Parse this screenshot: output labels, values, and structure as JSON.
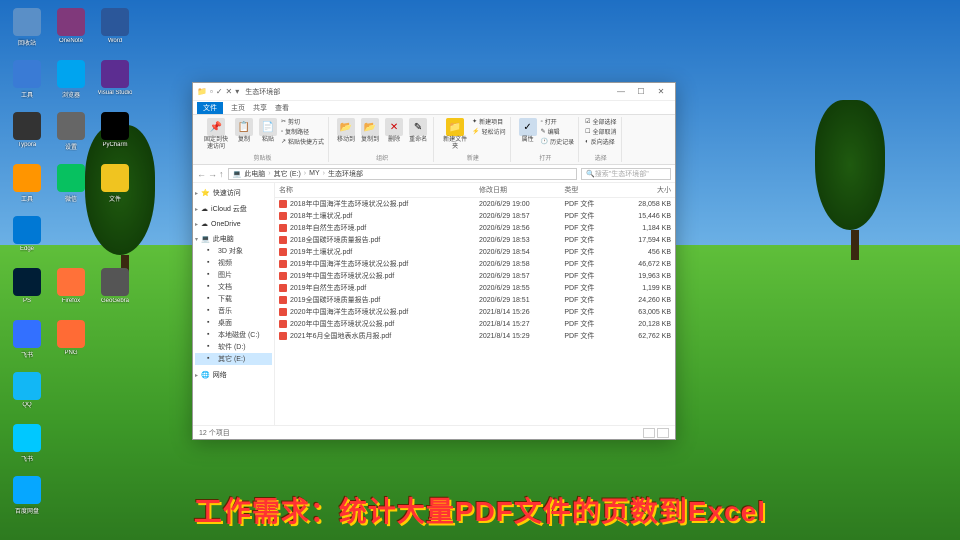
{
  "desktop": {
    "icons": [
      {
        "label": "回收站",
        "color": "#5a8fc7"
      },
      {
        "label": "OneNote",
        "color": "#80397b"
      },
      {
        "label": "Word",
        "color": "#2b579a"
      },
      {
        "label": "工具",
        "color": "#3a7bd5"
      },
      {
        "label": "浏览器",
        "color": "#00a4ef"
      },
      {
        "label": "Visual Studio",
        "color": "#5c2d91"
      },
      {
        "label": "Typora",
        "color": "#333"
      },
      {
        "label": "设置",
        "color": "#666"
      },
      {
        "label": "PyCharm",
        "color": "#000"
      },
      {
        "label": "工具",
        "color": "#ff9500"
      },
      {
        "label": "微信",
        "color": "#07c160"
      },
      {
        "label": "文件",
        "color": "#f0c420"
      },
      {
        "label": "Edge",
        "color": "#0078d4"
      },
      {
        "label": "",
        "color": "transparent"
      },
      {
        "label": "",
        "color": "transparent"
      },
      {
        "label": "PS",
        "color": "#001e36"
      },
      {
        "label": "Firefox",
        "color": "#ff7139"
      },
      {
        "label": "GeoGebra",
        "color": "#555"
      },
      {
        "label": "飞书",
        "color": "#3370ff"
      },
      {
        "label": "PNG",
        "color": "#ff6b35"
      },
      {
        "label": "",
        "color": "transparent"
      },
      {
        "label": "QQ",
        "color": "#12b7f5"
      },
      {
        "label": "",
        "color": "transparent"
      },
      {
        "label": "",
        "color": "transparent"
      },
      {
        "label": "飞书",
        "color": "#00c8ff"
      },
      {
        "label": "",
        "color": "transparent"
      },
      {
        "label": "",
        "color": "transparent"
      },
      {
        "label": "百度网盘",
        "color": "#06a7ff"
      }
    ]
  },
  "explorer": {
    "title": "生态环境部",
    "tabs": {
      "file": "文件",
      "home": "主页",
      "share": "共享",
      "view": "查看"
    },
    "ribbon": {
      "pin": "固定到快速访问",
      "copy": "复制",
      "paste": "粘贴",
      "cut": "剪切",
      "copypath": "复制路径",
      "shortcut": "粘贴快捷方式",
      "moveto": "移动到",
      "copyto": "复制到",
      "delete": "删除",
      "rename": "重命名",
      "newfolder": "新建文件夹",
      "newitem": "新建项目",
      "easyaccess": "轻松访问",
      "properties": "属性",
      "open": "打开",
      "edit": "编辑",
      "history": "历史记录",
      "selectall": "全部选择",
      "selectnone": "全部取消",
      "invertsel": "反向选择",
      "grp_clipboard": "剪贴板",
      "grp_organize": "组织",
      "grp_new": "新建",
      "grp_open": "打开",
      "grp_select": "选择"
    },
    "breadcrumb": [
      "此电脑",
      "其它 (E:)",
      "MY",
      "生态环境部"
    ],
    "search_placeholder": "搜索\"生态环境部\"",
    "sidebar": {
      "quick": "快速访问",
      "icloud": "iCloud 云盘",
      "onedrive": "OneDrive",
      "thispc": "此电脑",
      "items": [
        "3D 对象",
        "视频",
        "图片",
        "文档",
        "下载",
        "音乐",
        "桌面",
        "本地磁盘 (C:)",
        "软件 (D:)",
        "其它 (E:)"
      ],
      "network": "网络"
    },
    "columns": {
      "name": "名称",
      "date": "修改日期",
      "type": "类型",
      "size": "大小"
    },
    "files": [
      {
        "name": "2018年中国海洋生态环境状况公报.pdf",
        "date": "2020/6/29 19:00",
        "type": "PDF 文件",
        "size": "28,058 KB"
      },
      {
        "name": "2018年土壤状况.pdf",
        "date": "2020/6/29 18:57",
        "type": "PDF 文件",
        "size": "15,446 KB"
      },
      {
        "name": "2018年自然生态环境.pdf",
        "date": "2020/6/29 18:56",
        "type": "PDF 文件",
        "size": "1,184 KB"
      },
      {
        "name": "2018全国碳环境质量报告.pdf",
        "date": "2020/6/29 18:53",
        "type": "PDF 文件",
        "size": "17,594 KB"
      },
      {
        "name": "2019年土壤状况.pdf",
        "date": "2020/6/29 18:54",
        "type": "PDF 文件",
        "size": "456 KB"
      },
      {
        "name": "2019年中国海洋生态环境状况公报.pdf",
        "date": "2020/6/29 18:58",
        "type": "PDF 文件",
        "size": "46,672 KB"
      },
      {
        "name": "2019年中国生态环境状况公报.pdf",
        "date": "2020/6/29 18:57",
        "type": "PDF 文件",
        "size": "19,963 KB"
      },
      {
        "name": "2019年自然生态环境.pdf",
        "date": "2020/6/29 18:55",
        "type": "PDF 文件",
        "size": "1,199 KB"
      },
      {
        "name": "2019全国碳环境质量报告.pdf",
        "date": "2020/6/29 18:51",
        "type": "PDF 文件",
        "size": "24,260 KB"
      },
      {
        "name": "2020年中国海洋生态环境状况公报.pdf",
        "date": "2021/8/14 15:26",
        "type": "PDF 文件",
        "size": "63,005 KB"
      },
      {
        "name": "2020年中国生态环境状况公报.pdf",
        "date": "2021/8/14 15:27",
        "type": "PDF 文件",
        "size": "20,128 KB"
      },
      {
        "name": "2021年6月全国地表水质月报.pdf",
        "date": "2021/8/14 15:29",
        "type": "PDF 文件",
        "size": "62,762 KB"
      }
    ],
    "status": "12 个项目"
  },
  "caption": "工作需求：统计大量PDF文件的页数到Excel"
}
